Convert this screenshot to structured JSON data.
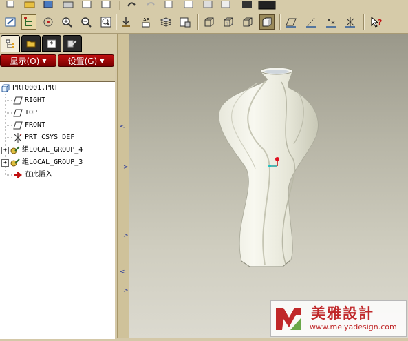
{
  "menu": {
    "display": "显示(O)",
    "settings": "设置(G)"
  },
  "tree": {
    "root": "PRT0001.PRT",
    "items": [
      "RIGHT",
      "TOP",
      "FRONT",
      "PRT_CSYS_DEF",
      "组LOCAL_GROUP_4",
      "组LOCAL_GROUP_3",
      "在此插入"
    ]
  },
  "watermark": {
    "brand": "美雅設計",
    "url": "www.meiyadesign.com"
  },
  "colors": {
    "menu_red": "#b01010",
    "tree_bg": "#ffffff",
    "toolbar_bg": "#d6cba9",
    "watermark_red": "#c0282a"
  },
  "icons": [
    "new-icon",
    "open-icon",
    "save-icon",
    "print-icon",
    "undo-icon",
    "redo-icon",
    "copy-icon",
    "paste-icon",
    "regenerate-icon",
    "model-tree-icon",
    "zoom-in-icon",
    "zoom-out-icon",
    "refit-icon",
    "saved-views-icon",
    "layers-icon",
    "wireframe-icon",
    "hidden-line-icon",
    "no-hidden-icon",
    "shading-icon",
    "datum-plane-icon",
    "datum-axis-icon",
    "datum-point-icon",
    "csys-icon",
    "help-icon"
  ]
}
